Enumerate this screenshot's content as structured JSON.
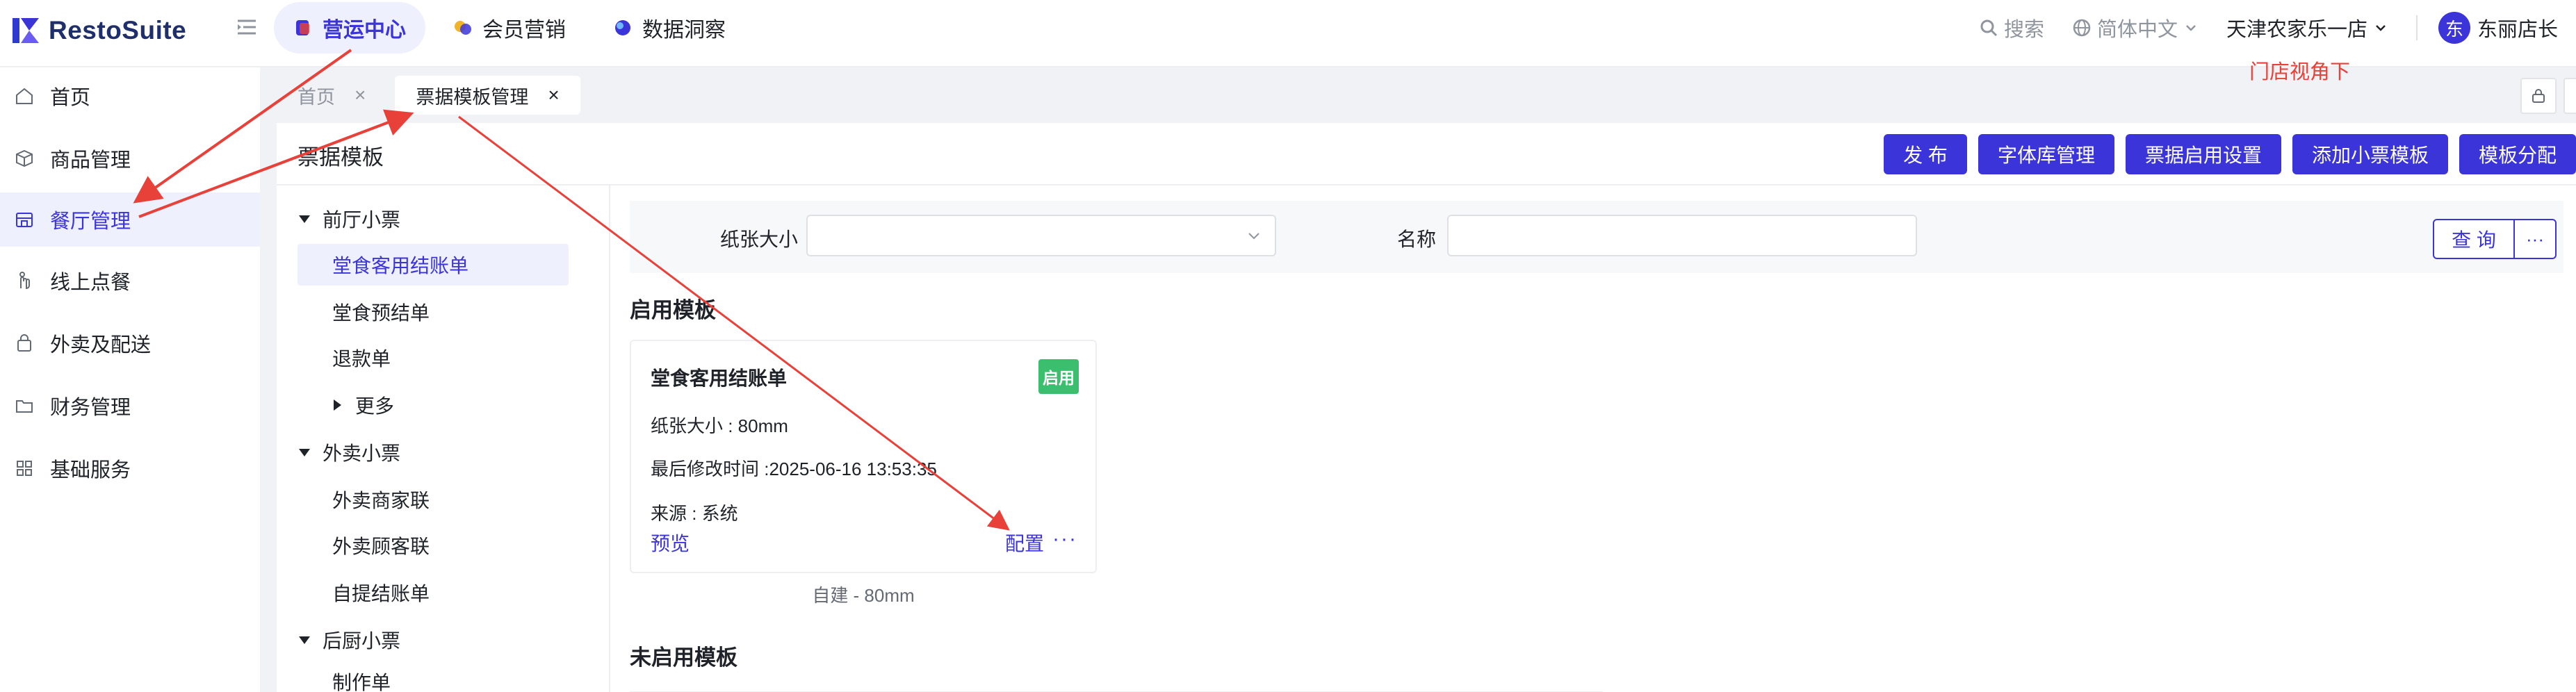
{
  "app": {
    "name": "RestoSuite",
    "nav": [
      {
        "label": "营运中心",
        "active": true
      },
      {
        "label": "会员营销",
        "active": false
      },
      {
        "label": "数据洞察",
        "active": false
      }
    ],
    "search_label": "搜索",
    "language": "简体中文",
    "store": "天津农家乐一店",
    "user_initial": "东",
    "user_name": "东丽店长"
  },
  "sidebar": {
    "items": [
      {
        "label": "首页",
        "icon": "home-icon"
      },
      {
        "label": "商品管理",
        "icon": "box-icon"
      },
      {
        "label": "餐厅管理",
        "icon": "store-icon",
        "active": true
      },
      {
        "label": "线上点餐",
        "icon": "hand-icon"
      },
      {
        "label": "外卖及配送",
        "icon": "bag-icon"
      },
      {
        "label": "财务管理",
        "icon": "folder-icon"
      },
      {
        "label": "基础服务",
        "icon": "grid-icon"
      }
    ]
  },
  "tabs": [
    {
      "label": "首页",
      "active": false
    },
    {
      "label": "票据模板管理",
      "active": true
    }
  ],
  "annotation_text": "门店视角下",
  "page": {
    "title": "票据模板",
    "actions": [
      "发 布",
      "字体库管理",
      "票据启用设置",
      "添加小票模板",
      "模板分配"
    ]
  },
  "tree": {
    "groups": [
      {
        "label": "前厅小票",
        "children": [
          "堂食客用结账单",
          "堂食预结单",
          "退款单"
        ],
        "more": "更多"
      },
      {
        "label": "外卖小票",
        "children": [
          "外卖商家联",
          "外卖顾客联",
          "自提结账单"
        ]
      },
      {
        "label": "后厨小票",
        "children": [
          "制作单"
        ]
      }
    ],
    "selected": "堂食客用结账单"
  },
  "filter": {
    "paper_size_label": "纸张大小",
    "name_label": "名称",
    "query_label": "查 询",
    "more_label": "···"
  },
  "enabled_section": {
    "title": "启用模板",
    "card": {
      "name": "堂食客用结账单",
      "status": "启用",
      "paper_size": "纸张大小 : 80mm",
      "modified": "最后修改时间 :2025-06-16 13:53:35",
      "source": "来源 : 系统",
      "preview": "预览",
      "configure": "配置",
      "more": "···"
    },
    "caption": "自建 - 80mm"
  },
  "disabled_section": {
    "title": "未启用模板"
  },
  "colors": {
    "brand": "#3b35d9",
    "annotation": "#e8413a",
    "badge": "#3bbf6e"
  }
}
